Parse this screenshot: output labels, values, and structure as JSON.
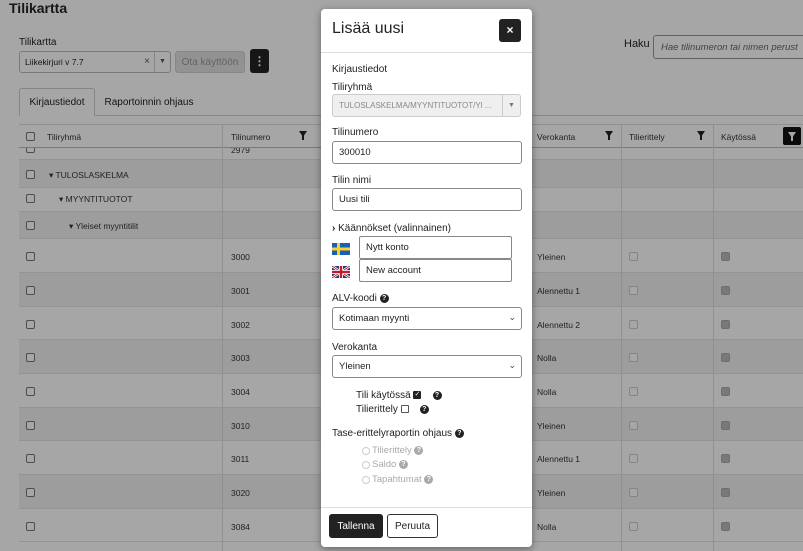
{
  "page": {
    "title": "Tilikartta",
    "chart_label": "Tilikartta",
    "chart_select": "Liikekirjuri v 7.7",
    "activate_button": "Ota käyttöön",
    "menu_glyph": "⋮",
    "search_label": "Haku",
    "search_placeholder": "Hae tilinumeron tai nimen perust"
  },
  "tabs": [
    {
      "label": "Kirjaustiedot"
    },
    {
      "label": "Raportoinnin ohjaus"
    }
  ],
  "grid": {
    "headers": {
      "group": "Tiliryhmä",
      "number": "Tilinumero",
      "tax": "Verokanta",
      "itemize": "Tilierittely",
      "active": "Käytössä"
    },
    "partial_row": "2979",
    "group_rows": [
      {
        "label": "▾ TULOSLASKELMA"
      },
      {
        "label": "▾ MYYNTITUOTOT"
      },
      {
        "label": "▾ Yleiset myyntitilit"
      }
    ],
    "rows": [
      {
        "number": "3000",
        "tax": "Yleinen"
      },
      {
        "number": "3001",
        "tax": "Alennettu 1"
      },
      {
        "number": "3002",
        "tax": "Alennettu 2"
      },
      {
        "number": "3003",
        "tax": "Nolla"
      },
      {
        "number": "3004",
        "tax": "Nolla"
      },
      {
        "number": "3010",
        "tax": "Yleinen"
      },
      {
        "number": "3011",
        "tax": "Alennettu 1"
      },
      {
        "number": "3020",
        "tax": "Yleinen"
      },
      {
        "number": "3084",
        "tax": "Nolla"
      }
    ]
  },
  "modal": {
    "title": "Lisää uusi",
    "close_glyph": "×",
    "section": "Kirjaustiedot",
    "group_label": "Tiliryhmä",
    "group_value": "TULOSLASKELMA/MYYNTITUOTOT/Yl ...",
    "number_label": "Tilinumero",
    "number_value": "300010",
    "name_label": "Tilin nimi",
    "name_value": "Uusi tili",
    "translations_label": "Käännökset (valinnainen)",
    "translation_sv": "Nytt konto",
    "translation_en": "New account",
    "vat_label": "ALV-koodi",
    "vat_value": "Kotimaan myynti",
    "tax_label": "Verokanta",
    "tax_value": "Yleinen",
    "active_label": "Tili käytössä",
    "itemize_label": "Tilierittely",
    "report_label": "Tase-erittelyraportin ohjaus",
    "report_options": [
      "Tilierittely",
      "Saldo",
      "Tapahtumat"
    ],
    "save_button": "Tallenna",
    "cancel_button": "Peruuta",
    "help_glyph": "?"
  }
}
